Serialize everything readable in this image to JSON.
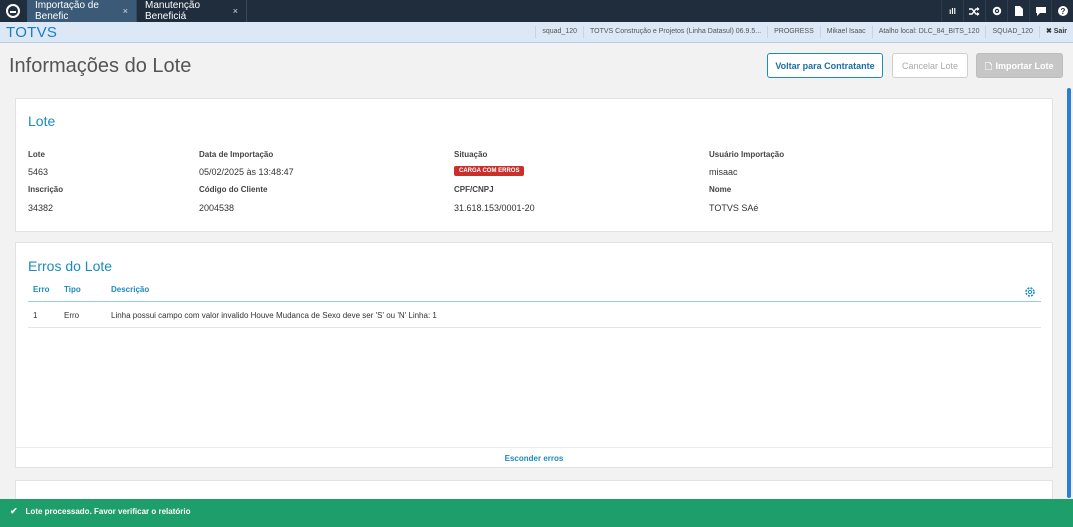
{
  "tabs": [
    {
      "label": "Importação de Benefic",
      "close": "×",
      "active": true
    },
    {
      "label": "Manutenção Beneficiá",
      "close": "×",
      "active": false
    }
  ],
  "top_icons": [
    "signal-icon",
    "shuffle-icon",
    "gear-icon",
    "document-icon",
    "chat-icon",
    "help-icon"
  ],
  "signal_text": "ıll",
  "header": {
    "brand": "TOTVS",
    "info": [
      "squad_120",
      "TOTVS Construção e Projetos (Linha Datasul) 06.9.5...",
      "PROGRESS",
      "Mikael Isaac",
      "Atalho local: DLC_84_BITS_120",
      "SQUAD_120"
    ],
    "logout": "✖ Sair"
  },
  "page": {
    "title": "Informações do Lote",
    "buttons": {
      "back": "Voltar para Contratante",
      "cancel": "Cancelar Lote",
      "import": "Importar Lote"
    }
  },
  "lote": {
    "title": "Lote",
    "fields": {
      "lote_label": "Lote",
      "lote_value": "5463",
      "data_label": "Data de Importação",
      "data_value": "05/02/2025 às 13:48:47",
      "situacao_label": "Situação",
      "situacao_value": "CARGA COM ERROS",
      "usuario_label": "Usuário Importação",
      "usuario_value": "misaac",
      "inscricao_label": "Inscrição",
      "inscricao_value": "34382",
      "codigo_label": "Código do Cliente",
      "codigo_value": "2004538",
      "cpf_label": "CPF/CNPJ",
      "cpf_value": "31.618.153/0001-20",
      "nome_label": "Nome",
      "nome_value": "TOTVS SAé"
    }
  },
  "erros": {
    "title": "Erros do Lote",
    "columns": [
      "Erro",
      "Tipo",
      "Descrição"
    ],
    "rows": [
      {
        "erro": "1",
        "tipo": "Erro",
        "descricao": "Linha possui campo com valor invalido Houve Mudanca de Sexo deve ser 'S' ou 'N' Linha: 1"
      }
    ],
    "hide_link": "Esconder erros"
  },
  "toast": {
    "icon": "check-icon",
    "message": "Lote processado. Favor verificar o relatório"
  },
  "colors": {
    "accent": "#1a8bbf",
    "topbar": "#1f2d3d",
    "error_badge": "#c9302c",
    "toast": "#1e9e6a"
  }
}
